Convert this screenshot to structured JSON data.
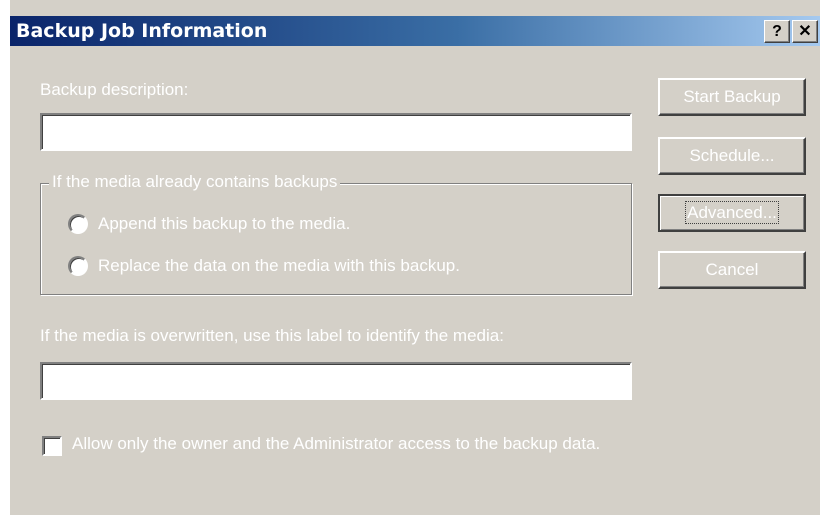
{
  "window": {
    "title": "Backup Job Information",
    "help_glyph": "?",
    "close_glyph": "✕"
  },
  "form": {
    "description_label": "Backup description:",
    "description_value": "",
    "media_group_label": "If the media already contains backups",
    "append_option": "Append this backup to the media.",
    "replace_option": "Replace the data on the media with this backup.",
    "label_field_label": "If the media is overwritten, use this label to identify the media:",
    "label_value": "",
    "access_checkbox_label": "Allow only the owner and the Administrator access to the backup data.",
    "access_checked": false
  },
  "buttons": {
    "start_backup": "Start Backup",
    "schedule": "Schedule...",
    "advanced": "Advanced...",
    "cancel": "Cancel"
  },
  "colors": {
    "dialog_face": "#d4d0c8",
    "title_gradient_start": "#0a246a",
    "title_gradient_end": "#a6caf0",
    "text": "#ffffff"
  }
}
